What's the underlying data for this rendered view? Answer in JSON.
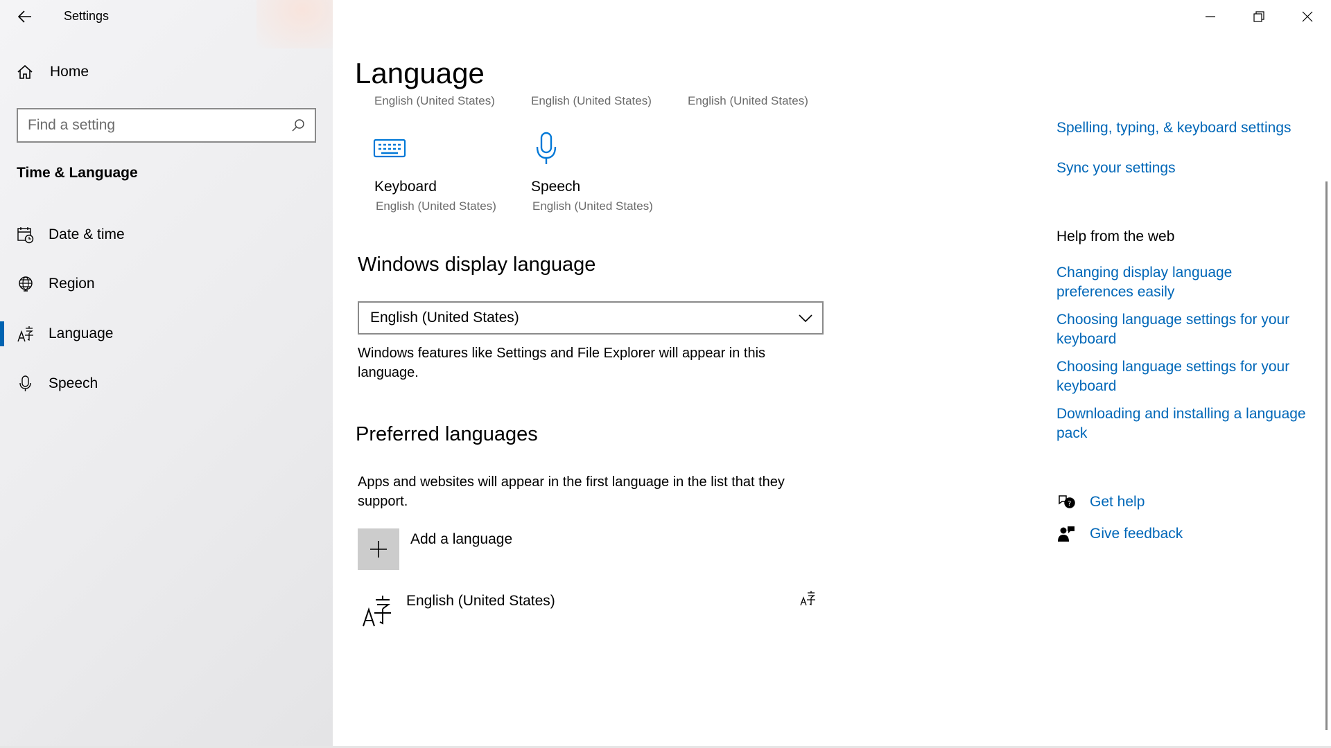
{
  "window": {
    "app_title": "Settings"
  },
  "sidebar": {
    "home_label": "Home",
    "search_placeholder": "Find a setting",
    "section_title": "Time & Language",
    "items": [
      {
        "label": "Date & time",
        "icon": "calendar-clock-icon"
      },
      {
        "label": "Region",
        "icon": "globe-icon"
      },
      {
        "label": "Language",
        "icon": "language-icon",
        "active": true
      },
      {
        "label": "Speech",
        "icon": "microphone-icon"
      }
    ]
  },
  "main": {
    "title": "Language",
    "top_tiles_partial": [
      "English (United States)",
      "English (United States)",
      "English (United States)"
    ],
    "tiles": [
      {
        "name": "Keyboard",
        "sub": "English (United States)",
        "icon": "keyboard-icon"
      },
      {
        "name": "Speech",
        "sub": "English (United States)",
        "icon": "microphone-icon"
      }
    ],
    "display_language": {
      "heading": "Windows display language",
      "selected": "English (United States)",
      "description": "Windows features like Settings and File Explorer will appear in this language."
    },
    "preferred": {
      "heading": "Preferred languages",
      "description": "Apps and websites will appear in the first language in the list that they support.",
      "add_label": "Add a language",
      "languages": [
        {
          "name": "English (United States)"
        }
      ]
    }
  },
  "right": {
    "related_links": [
      "Spelling, typing, & keyboard settings",
      "Sync your settings"
    ],
    "help_heading": "Help from the web",
    "help_links": [
      "Changing display language preferences easily",
      "Choosing language settings for your keyboard",
      "Choosing language settings for your keyboard",
      "Downloading and installing a language pack"
    ],
    "get_help": "Get help",
    "give_feedback": "Give feedback"
  },
  "colors": {
    "accent": "#0063b1",
    "link": "#0067b8",
    "icon_blue": "#0078d7"
  }
}
